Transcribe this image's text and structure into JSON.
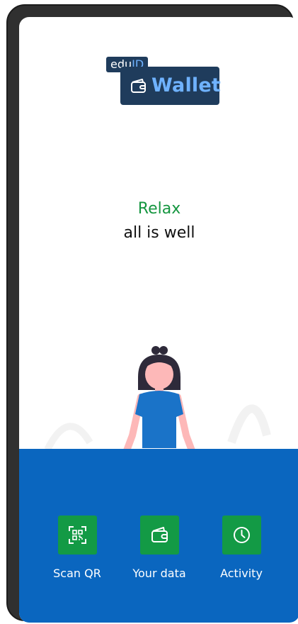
{
  "logo": {
    "prefix_text": "edu",
    "prefix_accent": "ID",
    "word": "Wallet",
    "icon": "wallet-icon"
  },
  "message": {
    "title": "Relax",
    "subtitle": "all is well"
  },
  "illustration": {
    "icon": "meditating-person-illustration"
  },
  "actions": [
    {
      "label": "Scan QR",
      "icon": "qr-scan-icon"
    },
    {
      "label": "Your data",
      "icon": "wallet-icon"
    },
    {
      "label": "Activity",
      "icon": "clock-icon"
    }
  ],
  "colors": {
    "brand_dark": "#1f3c5c",
    "brand_light": "#6fb2ff",
    "accent_green": "#159640",
    "panel_blue": "#0a66bf",
    "tile_green": "#139a45"
  }
}
